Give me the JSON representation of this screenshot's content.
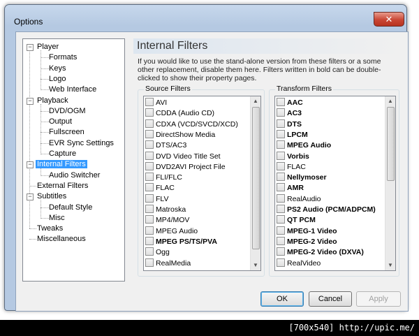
{
  "window": {
    "title": "Options",
    "close_glyph": "✕"
  },
  "tree": {
    "items": [
      "Player",
      "Formats",
      "Keys",
      "Logo",
      "Web Interface",
      "Playback",
      "DVD/OGM",
      "Output",
      "Fullscreen",
      "EVR Sync Settings",
      "Capture",
      "Internal Filters",
      "Audio Switcher",
      "External Filters",
      "Subtitles",
      "Default Style",
      "Misc",
      "Tweaks",
      "Miscellaneous"
    ],
    "selected": "Internal Filters"
  },
  "page": {
    "title": "Internal Filters",
    "description": "If you would like to use the stand-alone version from these filters or a some other replacement, disable them here. Filters written in bold can be double-clicked to show their property pages."
  },
  "source_filters": {
    "label": "Source Filters",
    "items": [
      {
        "label": "AVI",
        "bold": false
      },
      {
        "label": "CDDA (Audio CD)",
        "bold": false
      },
      {
        "label": "CDXA (VCD/SVCD/XCD)",
        "bold": false
      },
      {
        "label": "DirectShow Media",
        "bold": false
      },
      {
        "label": "DTS/AC3",
        "bold": false
      },
      {
        "label": "DVD Video Title Set",
        "bold": false
      },
      {
        "label": "DVD2AVI Project File",
        "bold": false
      },
      {
        "label": "FLI/FLC",
        "bold": false
      },
      {
        "label": "FLAC",
        "bold": false
      },
      {
        "label": "FLV",
        "bold": false
      },
      {
        "label": "Matroska",
        "bold": false
      },
      {
        "label": "MP4/MOV",
        "bold": false
      },
      {
        "label": "MPEG Audio",
        "bold": false
      },
      {
        "label": "MPEG PS/TS/PVA",
        "bold": true
      },
      {
        "label": "Ogg",
        "bold": false
      },
      {
        "label": "RealMedia",
        "bold": false
      }
    ]
  },
  "transform_filters": {
    "label": "Transform Filters",
    "items": [
      {
        "label": "AAC",
        "bold": true
      },
      {
        "label": "AC3",
        "bold": true
      },
      {
        "label": "DTS",
        "bold": true
      },
      {
        "label": "LPCM",
        "bold": true
      },
      {
        "label": "MPEG Audio",
        "bold": true
      },
      {
        "label": "Vorbis",
        "bold": true
      },
      {
        "label": "FLAC",
        "bold": false
      },
      {
        "label": "Nellymoser",
        "bold": true
      },
      {
        "label": "AMR",
        "bold": true
      },
      {
        "label": "RealAudio",
        "bold": false
      },
      {
        "label": "PS2 Audio (PCM/ADPCM)",
        "bold": true
      },
      {
        "label": "QT PCM",
        "bold": true
      },
      {
        "label": "MPEG-1 Video",
        "bold": true
      },
      {
        "label": "MPEG-2 Video",
        "bold": true
      },
      {
        "label": "MPEG-2 Video (DXVA)",
        "bold": true
      },
      {
        "label": "RealVideo",
        "bold": false
      }
    ]
  },
  "buttons": {
    "ok": "OK",
    "cancel": "Cancel",
    "apply": "Apply"
  },
  "caption": "[700x540] http://upic.me/",
  "colors": {
    "selection": "#3399ff",
    "close": "#c94634"
  }
}
